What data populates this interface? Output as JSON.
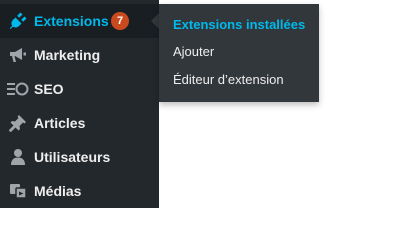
{
  "sidebar": {
    "items": [
      {
        "label": "Extensions",
        "icon": "plugin-icon",
        "active": true,
        "badge": "7"
      },
      {
        "label": "Marketing",
        "icon": "megaphone-icon",
        "active": false
      },
      {
        "label": "SEO",
        "icon": "seo-icon",
        "active": false
      },
      {
        "label": "Articles",
        "icon": "pin-icon",
        "active": false
      },
      {
        "label": "Utilisateurs",
        "icon": "user-icon",
        "active": false
      },
      {
        "label": "Médias",
        "icon": "media-icon",
        "active": false
      }
    ]
  },
  "submenu": {
    "items": [
      {
        "label": "Extensions installées",
        "current": true
      },
      {
        "label": "Ajouter",
        "current": false
      },
      {
        "label": "Éditeur d’extension",
        "current": false
      }
    ]
  },
  "colors": {
    "sidebar_bg": "#23282d",
    "active_bg": "#191e23",
    "flyout_bg": "#32373c",
    "accent": "#00b9eb",
    "badge": "#ca4a1f",
    "text": "#eeeeee"
  }
}
